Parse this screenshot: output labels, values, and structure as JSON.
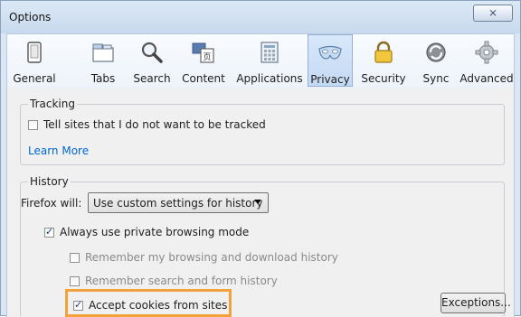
{
  "window": {
    "title": "Options",
    "close_glyph": "⨯"
  },
  "toolbar": {
    "items": [
      {
        "label": "General",
        "icon": "general-icon"
      },
      {
        "label": "Tabs",
        "icon": "tabs-icon"
      },
      {
        "label": "Search",
        "icon": "search-icon"
      },
      {
        "label": "Content",
        "icon": "content-icon"
      },
      {
        "label": "Applications",
        "icon": "applications-icon"
      },
      {
        "label": "Privacy",
        "icon": "privacy-mask-icon",
        "selected": true
      },
      {
        "label": "Security",
        "icon": "lock-icon"
      },
      {
        "label": "Sync",
        "icon": "sync-icon"
      },
      {
        "label": "Advanced",
        "icon": "gear-icon"
      }
    ]
  },
  "tracking": {
    "legend": "Tracking",
    "dnt_label": "Tell sites that I do not want to be tracked",
    "dnt_checked": false,
    "learn_more": "Learn More"
  },
  "history": {
    "legend": "History",
    "firefox_will_label": "Firefox will:",
    "mode_value": "Use custom settings for history",
    "private_label": "Always use private browsing mode",
    "private_checked": true,
    "remember_browsing_label": "Remember my browsing and download history",
    "remember_search_label": "Remember search and form history",
    "accept_cookies_label": "Accept cookies from sites",
    "accept_cookies_checked": true,
    "exceptions_label": "Exceptions..."
  },
  "colors": {
    "highlight": "#f2a23a",
    "link": "#0066cc",
    "selected_tab": "#c4d9f3"
  }
}
